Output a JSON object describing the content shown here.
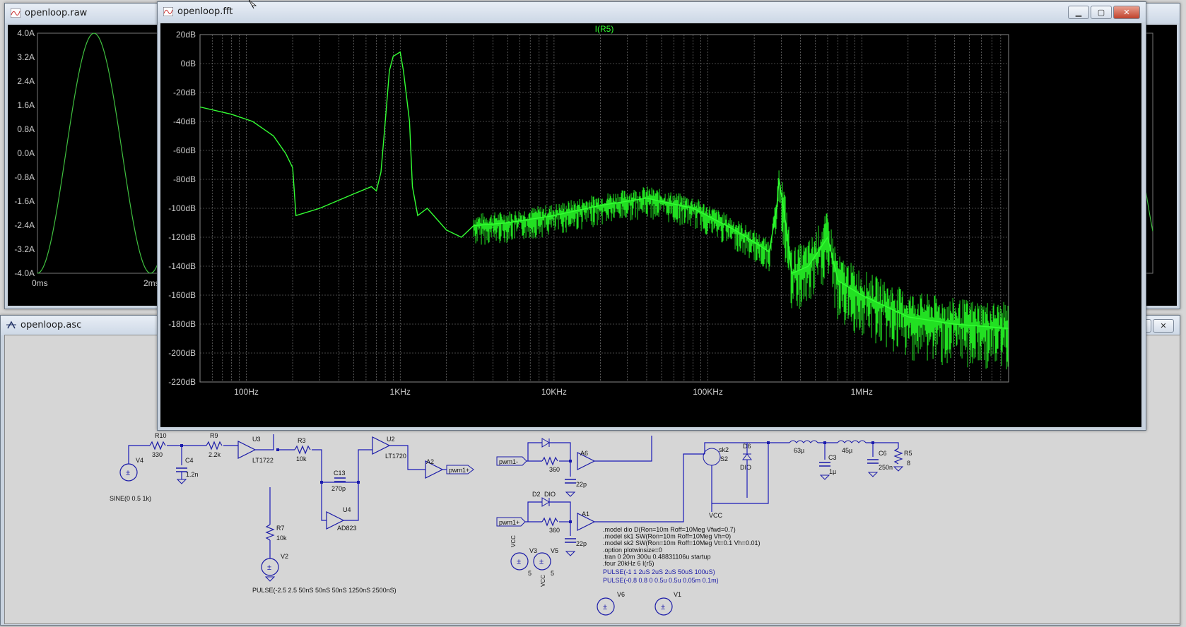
{
  "raw_window": {
    "title": "openloop.raw",
    "y_ticks": [
      "4.0A",
      "3.2A",
      "2.4A",
      "1.6A",
      "0.8A",
      "0.0A",
      "-0.8A",
      "-1.6A",
      "-2.4A",
      "-3.2A",
      "-4.0A"
    ],
    "x_ticks": [
      "0ms",
      "2ms"
    ]
  },
  "asc_window": {
    "title": "openloop.asc"
  },
  "fft_window": {
    "title": "openloop.fft",
    "buttons": {
      "minimize": "▁",
      "maximize": "▢",
      "close": "✕"
    }
  },
  "chart_data": {
    "type": "line",
    "title": "I(R5)",
    "xscale": "log",
    "xlim": [
      50,
      9000000
    ],
    "ylim": [
      -220,
      20
    ],
    "grid": true,
    "y_ticks": [
      "20dB",
      "0dB",
      "-20dB",
      "-40dB",
      "-60dB",
      "-80dB",
      "-100dB",
      "-120dB",
      "-140dB",
      "-160dB",
      "-180dB",
      "-200dB",
      "-220dB"
    ],
    "x_ticks": [
      "100Hz",
      "1KHz",
      "10KHz",
      "100KHz",
      "1MHz"
    ],
    "series": [
      {
        "color": "#33ff33",
        "x": [
          50,
          80,
          110,
          150,
          180,
          200,
          210,
          300,
          500,
          650,
          700,
          750,
          800,
          850,
          900,
          1000,
          1050,
          1150,
          1200,
          1300,
          1500,
          2000,
          2500,
          3000,
          5000,
          10000,
          20000,
          40000,
          80000,
          150000,
          250000,
          280000,
          290000,
          320000,
          350000,
          450000,
          600000,
          700000,
          1000000,
          2000000,
          4000000,
          9000000
        ],
        "y": [
          -30,
          -35,
          -40,
          -50,
          -62,
          -72,
          -105,
          -100,
          -90,
          -85,
          -88,
          -75,
          -40,
          -5,
          5,
          8,
          -5,
          -40,
          -85,
          -105,
          -100,
          -115,
          -120,
          -112,
          -110,
          -105,
          -98,
          -93,
          -100,
          -115,
          -130,
          -100,
          -80,
          -110,
          -145,
          -140,
          -120,
          -150,
          -160,
          -175,
          -180,
          -183
        ]
      }
    ]
  },
  "schematic": {
    "labels": {
      "r10": "R10",
      "r10v": "330",
      "r9": "R9",
      "r9v": "2.2k",
      "u3": "U3",
      "u3p": "LT1722",
      "r3": "R3",
      "r3v": "10k",
      "u2": "U2",
      "u2p": "LT1720",
      "c13": "C13",
      "c13v": "270p",
      "u4": "U4",
      "u4p": "AD823",
      "v4": "V4",
      "c4": "C4",
      "c4v": "1.2n",
      "sine": "SINE(0 0.5 1k)",
      "r7": "R7",
      "r7v": "10k",
      "v2": "V2",
      "pulse1": "PULSE(-2.5 2.5 50nS 50nS 50nS 1250nS 2500nS)",
      "a2": "A2",
      "pwm1p": "pwm1+",
      "pwm1m": "pwm1-",
      "r360a": "360",
      "a6": "A6",
      "c22a": "22p",
      "d2": "D2",
      "dio": "DIO",
      "pwm1p2": "pwm1+",
      "r360b": "360",
      "a1": "A1",
      "c22b": "22p",
      "sk2": "sk2",
      "s2": "S2",
      "d6": "D6",
      "dio2": "DIO",
      "l63": "63µ",
      "l45": "45µ",
      "c3": "C3",
      "c3v": "1µ",
      "c6": "C6",
      "c6v": "250n",
      "r5": "R5",
      "r5v": "8",
      "v3": "V3",
      "v3v": "5",
      "v5": "V5",
      "v5v": "5",
      "v6": "V6",
      "v1": "V1",
      "vcc": "VCC"
    },
    "spice": [
      ".model dio D(Ron=10m Roff=10Meg Vfwd=0.7)",
      ".model sk1 SW(Ron=10m Roff=10Meg Vh=0)",
      ".model sk2 SW(Ron=10m Roff=10Meg Vt=0.1 Vh=0.01)",
      ".option plotwinsize=0",
      ".tran 0 20m 300u 0.48831106u startup",
      ".four 20kHz 6  I(r5)"
    ],
    "pulses": [
      "PULSE(-1 1 2uS 2uS 2uS 50uS 100uS)",
      "PULSE(-0.8 0.8 0 0.5u 0.5u 0.05m 0.1m)"
    ]
  }
}
